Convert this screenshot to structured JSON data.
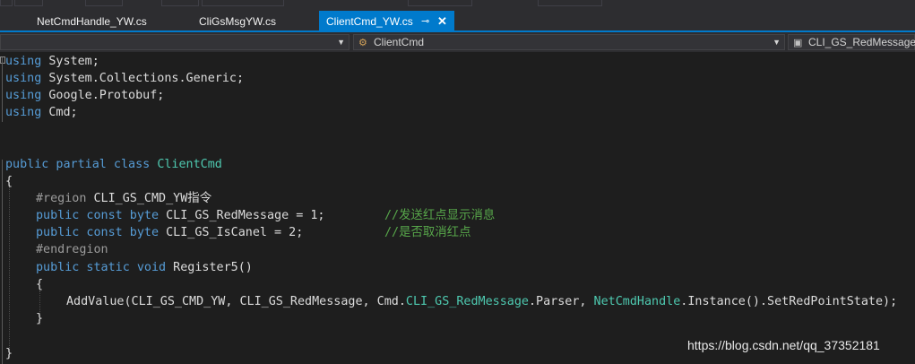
{
  "tabs": [
    {
      "label": "NetCmdHandle_YW.cs"
    },
    {
      "label": "CliGsMsgYW.cs"
    },
    {
      "label": "ClientCmd_YW.cs",
      "pin": "⊸",
      "close": "✕"
    }
  ],
  "nav": {
    "class_dropdown": "ClientCmd",
    "member_dropdown": "CLI_GS_RedMessage"
  },
  "code": {
    "line1": "using",
    "line1b": " System;",
    "line2": "using",
    "line2b": " System.Collections.Generic;",
    "line3": "using",
    "line3b": " Google.Protobuf;",
    "line4": "using",
    "line4b": " Cmd;",
    "cls_kw": "public partial class",
    "cls_name": "ClientCmd",
    "brace_open": "{",
    "region": "#region",
    "region_name": " CLI_GS_CMD_YW指令",
    "f1_kw": "public const byte",
    "f1_rest": " CLI_GS_RedMessage = 1;",
    "f1_comment": "//发送红点显示消息",
    "f2_kw": "public const byte",
    "f2_rest": " CLI_GS_IsCanel = 2;",
    "f2_comment": "//是否取消红点",
    "endregion": "#endregion",
    "m_kw": "public static void",
    "m_name": " Register5()",
    "m_open": "{",
    "call_a": "AddValue(CLI_GS_CMD_YW, CLI_GS_RedMessage, Cmd.",
    "call_b": "CLI_GS_RedMessage",
    "call_c": ".Parser, ",
    "call_d": "NetCmdHandle",
    "call_e": ".Instance().SetRedPointState);",
    "m_close": "}",
    "brace_close": "}"
  },
  "watermark": "https://blog.csdn.net/qq_37352181",
  "colors": {
    "background": "#1e1e1e",
    "keyword": "#569cd6",
    "type": "#4ec9b0",
    "comment": "#57a64a",
    "accent": "#007acc"
  }
}
